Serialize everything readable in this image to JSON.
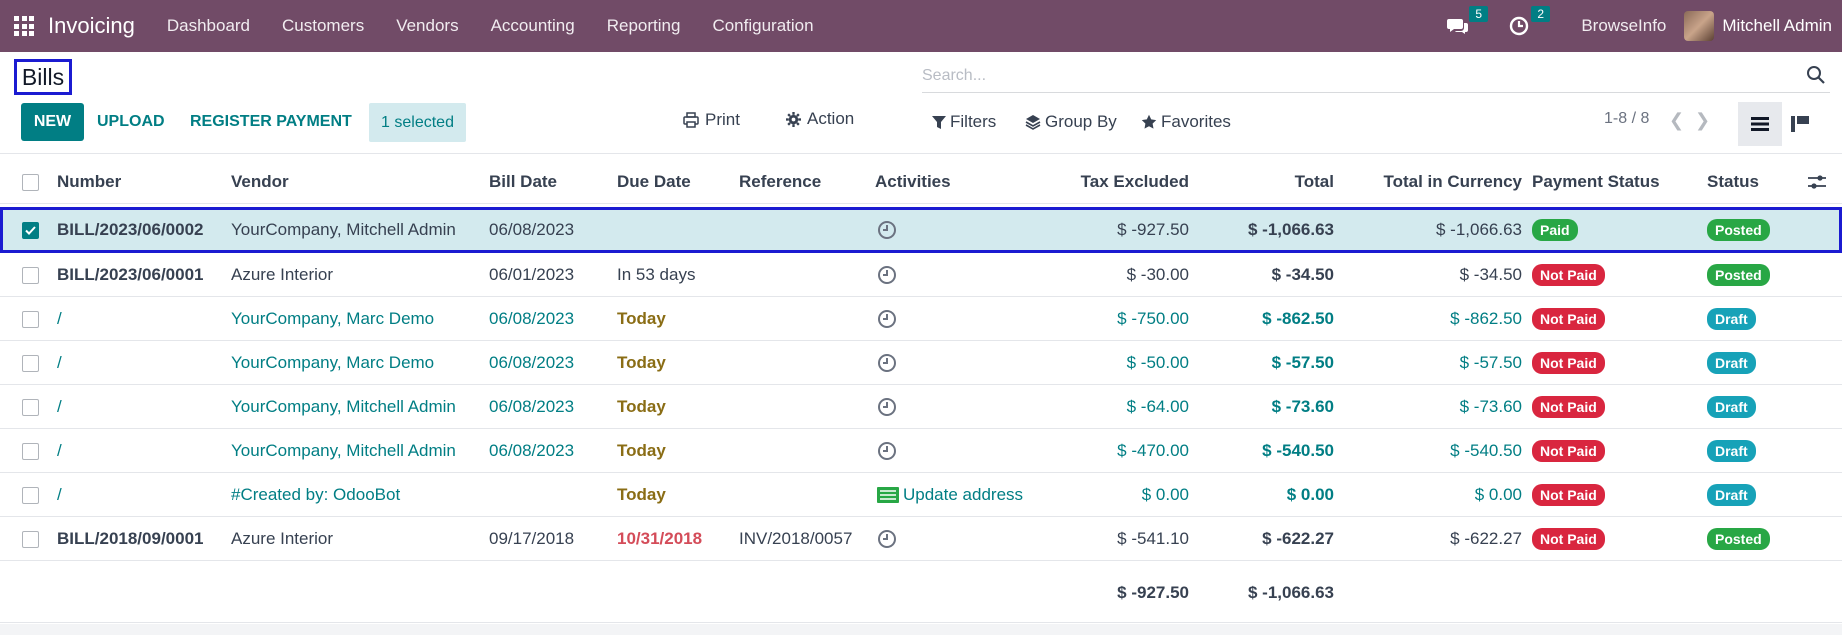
{
  "navbar": {
    "app_name": "Invoicing",
    "menu": [
      "Dashboard",
      "Customers",
      "Vendors",
      "Accounting",
      "Reporting",
      "Configuration"
    ],
    "messages_count": "5",
    "activities_count": "2",
    "company": "BrowseInfo",
    "user": "Mitchell Admin"
  },
  "control_panel": {
    "title": "Bills",
    "search_placeholder": "Search...",
    "new_label": "NEW",
    "upload_label": "UPLOAD",
    "register_payment_label": "REGISTER PAYMENT",
    "selected_label": "1 selected",
    "print_label": "Print",
    "action_label": "Action",
    "filters_label": "Filters",
    "group_by_label": "Group By",
    "favorites_label": "Favorites",
    "pager": "1-8 / 8"
  },
  "table": {
    "columns": [
      "Number",
      "Vendor",
      "Bill Date",
      "Due Date",
      "Reference",
      "Activities",
      "Tax Excluded",
      "Total",
      "Total in Currency",
      "Payment Status",
      "Status"
    ],
    "rows": [
      {
        "number": "BILL/2023/06/0002",
        "vendor": "YourCompany, Mitchell Admin",
        "bill_date": "06/08/2023",
        "due_date": "",
        "reference": "",
        "activity": "",
        "tax_excluded": "$ -927.50",
        "total": "$ -1,066.63",
        "total_currency": "$ -1,066.63",
        "payment_status": "Paid",
        "status": "Posted"
      },
      {
        "number": "BILL/2023/06/0001",
        "vendor": "Azure Interior",
        "bill_date": "06/01/2023",
        "due_date": "In 53 days",
        "reference": "",
        "activity": "",
        "tax_excluded": "$ -30.00",
        "total": "$ -34.50",
        "total_currency": "$ -34.50",
        "payment_status": "Not Paid",
        "status": "Posted"
      },
      {
        "number": "/",
        "vendor": "YourCompany, Marc Demo",
        "bill_date": "06/08/2023",
        "due_date": "Today",
        "reference": "",
        "activity": "",
        "tax_excluded": "$ -750.00",
        "total": "$ -862.50",
        "total_currency": "$ -862.50",
        "payment_status": "Not Paid",
        "status": "Draft"
      },
      {
        "number": "/",
        "vendor": "YourCompany, Marc Demo",
        "bill_date": "06/08/2023",
        "due_date": "Today",
        "reference": "",
        "activity": "",
        "tax_excluded": "$ -50.00",
        "total": "$ -57.50",
        "total_currency": "$ -57.50",
        "payment_status": "Not Paid",
        "status": "Draft"
      },
      {
        "number": "/",
        "vendor": "YourCompany, Mitchell Admin",
        "bill_date": "06/08/2023",
        "due_date": "Today",
        "reference": "",
        "activity": "",
        "tax_excluded": "$ -64.00",
        "total": "$ -73.60",
        "total_currency": "$ -73.60",
        "payment_status": "Not Paid",
        "status": "Draft"
      },
      {
        "number": "/",
        "vendor": "YourCompany, Mitchell Admin",
        "bill_date": "06/08/2023",
        "due_date": "Today",
        "reference": "",
        "activity": "",
        "tax_excluded": "$ -470.00",
        "total": "$ -540.50",
        "total_currency": "$ -540.50",
        "payment_status": "Not Paid",
        "status": "Draft"
      },
      {
        "number": "/",
        "vendor": "#Created by: OdooBot",
        "bill_date": "",
        "due_date": "Today",
        "reference": "",
        "activity": "Update address",
        "tax_excluded": "$ 0.00",
        "total": "$ 0.00",
        "total_currency": "$ 0.00",
        "payment_status": "Not Paid",
        "status": "Draft"
      },
      {
        "number": "BILL/2018/09/0001",
        "vendor": "Azure Interior",
        "bill_date": "09/17/2018",
        "due_date": "10/31/2018",
        "reference": "INV/2018/0057",
        "activity": "",
        "tax_excluded": "$ -541.10",
        "total": "$ -622.27",
        "total_currency": "$ -622.27",
        "payment_status": "Not Paid",
        "status": "Posted"
      }
    ],
    "totals": {
      "tax_excluded": "$ -927.50",
      "total": "$ -1,066.63"
    }
  },
  "colors": {
    "navbar": "#714b67",
    "primary": "#017e84",
    "selected_row": "#d3eaee",
    "highlight_border": "#1b1bd1",
    "paid": "#28a745",
    "not_paid": "#d9263f",
    "draft": "#17a2b8",
    "today": "#8a6d15",
    "overdue": "#d44c59"
  }
}
